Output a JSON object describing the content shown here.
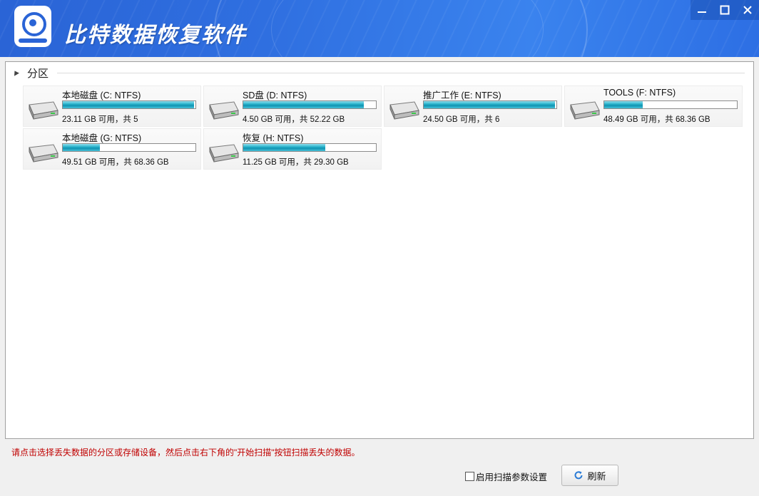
{
  "app": {
    "title": "比特数据恢复软件"
  },
  "window_controls": [
    "minimize",
    "maximize",
    "close"
  ],
  "section": {
    "label": "分区"
  },
  "drives": [
    {
      "name": "本地磁盘 (C: NTFS)",
      "size_text": "23.11 GB 可用，共 5",
      "used_fraction": 0.99
    },
    {
      "name": "SD盘 (D: NTFS)",
      "size_text": "4.50 GB 可用，共 52.22 GB",
      "used_fraction": 0.91
    },
    {
      "name": "推广工作 (E: NTFS)",
      "size_text": "24.50 GB 可用，共 6",
      "used_fraction": 0.99
    },
    {
      "name": "TOOLS (F: NTFS)",
      "size_text": "48.49 GB 可用，共 68.36 GB",
      "used_fraction": 0.29
    },
    {
      "name": "本地磁盘 (G: NTFS)",
      "size_text": "49.51 GB 可用，共 68.36 GB",
      "used_fraction": 0.28
    },
    {
      "name": "恢复 (H: NTFS)",
      "size_text": "11.25 GB 可用，共 29.30 GB",
      "used_fraction": 0.62
    }
  ],
  "hint": "请点击选择丢失数据的分区或存储设备，然后点击右下角的\"开始扫描\"按钮扫描丢失的数据。",
  "scan_settings": {
    "label": "启用扫描参数设置",
    "checked": false
  },
  "refresh": {
    "label": "刷新"
  },
  "colors": {
    "titlebar": "#2f6fe0",
    "hint": "#c00000",
    "bar_fill": "#1ea5c2"
  }
}
